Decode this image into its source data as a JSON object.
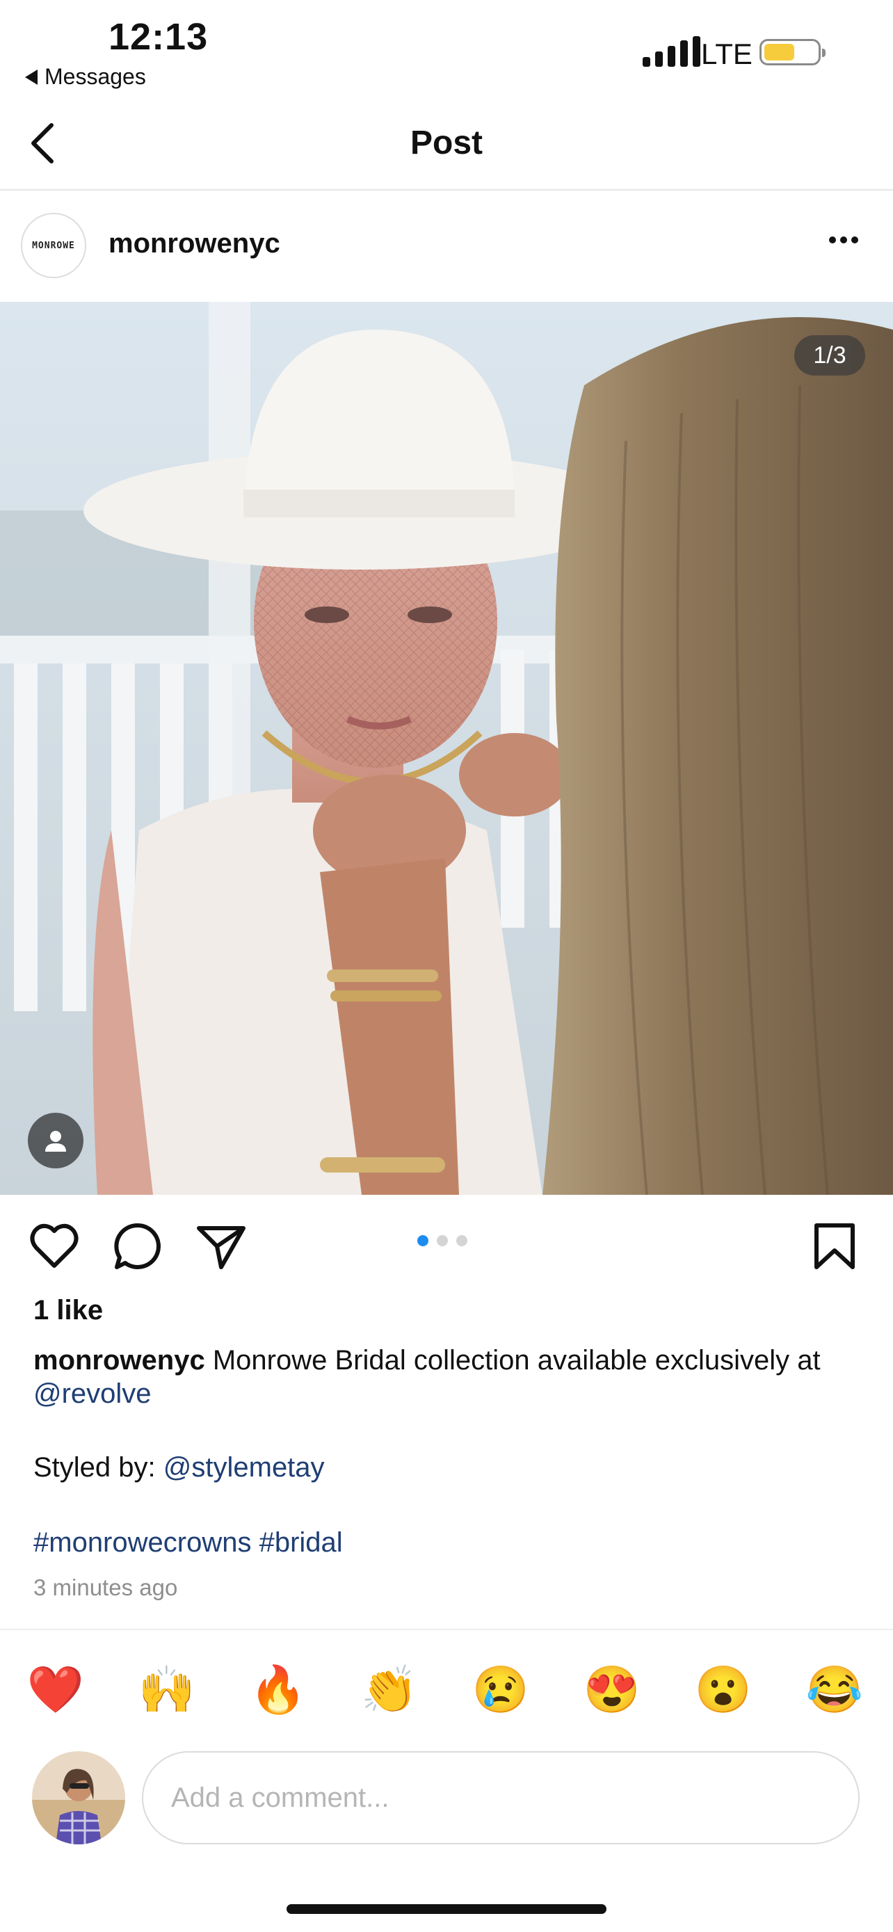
{
  "status_bar": {
    "time": "12:13",
    "back_app": "Messages",
    "network": "LTE",
    "battery_level": 0.58
  },
  "header": {
    "title": "Post"
  },
  "post": {
    "author": "monrowenyc",
    "avatar_logo_text": "MONROWE",
    "image_counter": "1/3",
    "carousel": {
      "total": 3,
      "active_index": 0
    },
    "likes": "1 like",
    "caption": {
      "author": "monrowenyc",
      "text": "Monrowe Bridal collection available exclusively at ",
      "mention": "@revolve"
    },
    "styled_by_label": "Styled by: ",
    "styled_by_mention": "@stylemetay",
    "hashtags": [
      "#monrowecrowns",
      "#bridal"
    ],
    "timestamp": "3 minutes ago"
  },
  "reactions": [
    {
      "name": "red-heart",
      "glyph": "❤️"
    },
    {
      "name": "raising-hands",
      "glyph": "🙌"
    },
    {
      "name": "fire",
      "glyph": "🔥"
    },
    {
      "name": "clapping-hands",
      "glyph": "👏"
    },
    {
      "name": "crying-face",
      "glyph": "😢"
    },
    {
      "name": "heart-eyes",
      "glyph": "😍"
    },
    {
      "name": "surprised-face",
      "glyph": "😮"
    },
    {
      "name": "tears-of-joy",
      "glyph": "😂"
    }
  ],
  "comment": {
    "placeholder": "Add a comment..."
  },
  "colors": {
    "link": "#1f3e73",
    "active_dot": "#1d8cf0",
    "battery": "#f6cc3c"
  }
}
